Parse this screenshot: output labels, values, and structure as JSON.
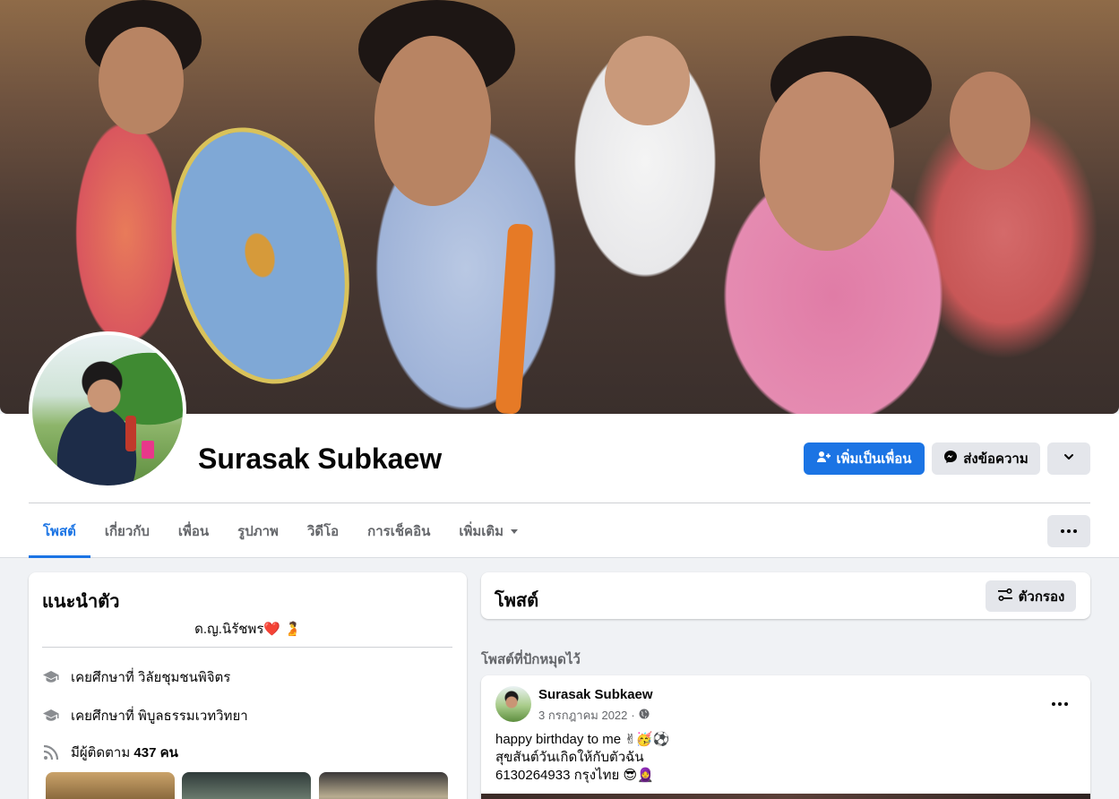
{
  "profile": {
    "name": "Surasak Subkaew"
  },
  "actions": {
    "add_friend": "เพิ่มเป็นเพื่อน",
    "message": "ส่งข้อความ"
  },
  "tabs": [
    {
      "label": "โพสต์"
    },
    {
      "label": "เกี่ยวกับ"
    },
    {
      "label": "เพื่อน"
    },
    {
      "label": "รูปภาพ"
    },
    {
      "label": "วิดีโอ"
    },
    {
      "label": "การเช็คอิน"
    },
    {
      "label": "เพิ่มเติม"
    }
  ],
  "intro": {
    "title": "แนะนำตัว",
    "bio_text": "ด.ญ.นิรัชพร",
    "bio_heart": "❤️",
    "bio_emoji": "🫄",
    "education": [
      {
        "prefix": "เคยศึกษาที่",
        "school": "วิลัยชุมชนพิจิตร"
      },
      {
        "prefix": "เคยศึกษาที่",
        "school": "พิบูลธรรมเวทวิทยา"
      }
    ],
    "followers_prefix": "มีผู้ติดตาม",
    "followers_count": "437",
    "followers_suffix": "คน"
  },
  "posts": {
    "title": "โพสต์",
    "filter_label": "ตัวกรอง",
    "pinned_label": "โพสต์ที่ปักหมุดไว้",
    "pinned_post": {
      "author": "Surasak Subkaew",
      "date": "3 กรกฎาคม 2022",
      "line1": "happy birthday to me ✌🥳⚽",
      "line2": "สุขสันต์วันเกิดให้กับตัวฉัน",
      "line3": "6130264933 กรุงไทย  😎🧕"
    }
  },
  "icons": {
    "add_friend": "person-add-icon",
    "message": "messenger-icon",
    "chevron": "chevron-down-icon",
    "more": "more-horizontal-icon",
    "filter": "filter-icon",
    "education": "graduation-cap-icon",
    "followers": "rss-icon",
    "privacy": "globe-icon"
  },
  "colors": {
    "accent": "#1b74e4",
    "background": "#f0f2f5",
    "secondary_button": "#e4e6eb",
    "muted_text": "#65676b"
  }
}
